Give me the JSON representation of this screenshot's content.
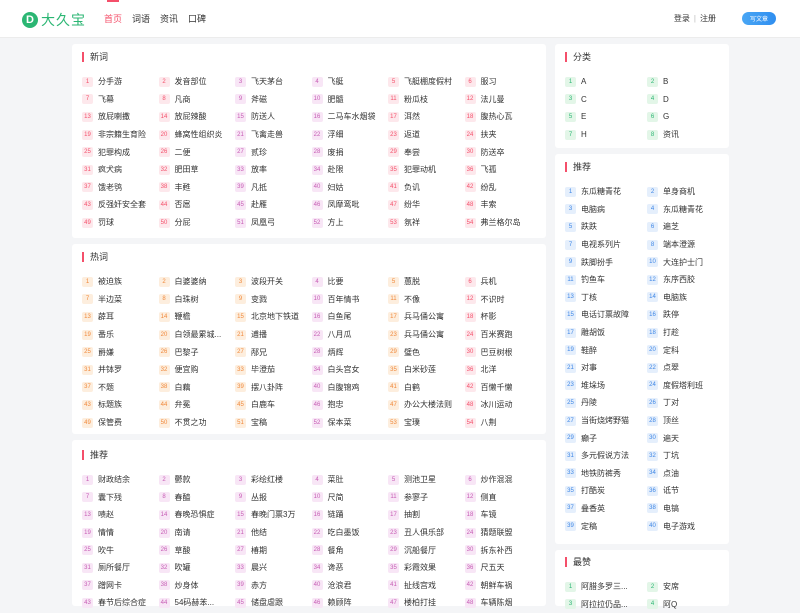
{
  "header": {
    "logo_letter": "D",
    "logo_text": "大久宝",
    "nav": [
      "首页",
      "词语",
      "资讯",
      "口碑"
    ],
    "login": "登录",
    "separator": "|",
    "register": "注册",
    "write_button": "写文章"
  },
  "sections": {
    "new": {
      "title": "新词",
      "items": [
        "分手游",
        "发音部位",
        "飞天茅台",
        "飞艇",
        "飞艇棚度假村",
        "服习",
        "飞幕",
        "凡商",
        "斧磁",
        "肥髓",
        "粉瓜枝",
        "法儿曼",
        "放屁喇撒",
        "放屁辣酸",
        "防送人",
        "二马车水烟袋",
        "洱然",
        "腹热心瓦",
        "非宗籍生育险",
        "蜂窝性组织炎",
        "飞禽走兽",
        "浮细",
        "返道",
        "扶夹",
        "犯罪构成",
        "二便",
        "贰珍",
        "废捐",
        "奉尝",
        "防送卒",
        "疯犬病",
        "肥田草",
        "放率",
        "赴限",
        "犯罪动机",
        "飞孤",
        "饿老鸮",
        "丰甦",
        "凡抵",
        "妇姑",
        "负讥",
        "纷乱",
        "反强奸安全套",
        "否扈",
        "赴雁",
        "凤靡鸾吡",
        "纷华",
        "丰索",
        "罚球",
        "分屁",
        "凤凰弓",
        "方上",
        "氛祥",
        "弗兰格尔岛"
      ]
    },
    "hot": {
      "title": "热词",
      "items": [
        "被迫族",
        "白婆婆纳",
        "波段开关",
        "比要",
        "蕙脱",
        "兵机",
        "半边菜",
        "白珠树",
        "变戮",
        "百年情书",
        "不像",
        "不识时",
        "薜耳",
        "鞭檐",
        "北京地下铁道",
        "白鱼尾",
        "兵马俑公寓",
        "杯影",
        "番乐",
        "白领最累城...",
        "逋播",
        "八月瓜",
        "兵马俑公寓",
        "百米赛跑",
        "爵嫌",
        "巴黎子",
        "邴兄",
        "炳辉",
        "璧色",
        "巴豆树根",
        "并钵罗",
        "便宜购",
        "毕澄茄",
        "白头宫女",
        "白米砂莲",
        "北洋",
        "不题",
        "白藕",
        "摆八卦阵",
        "白腹锦鸡",
        "白鹤",
        "百懒千懒",
        "标题族",
        "弁冕",
        "白鹿车",
        "抱忠",
        "办公大楼法则",
        "冰川运动",
        "保管费",
        "不贯之功",
        "宝稿",
        "保本菜",
        "宝璞",
        "八荆"
      ]
    },
    "rec": {
      "title": "推荐",
      "items": [
        "财政结余",
        "鬱款",
        "彩绘红楼",
        "菜肚",
        "测池卫星",
        "炒作混混",
        "囊下残",
        "春醯",
        "丛报",
        "尺简",
        "参寥子",
        "侧直",
        "啧赵",
        "春晚恐惧症",
        "春晚门票3万",
        "链踊",
        "抽割",
        "车镜",
        "情情",
        "南请",
        "他结",
        "吃白墨饭",
        "丑人俱乐部",
        "猜题联盟",
        "吹牛",
        "草酸",
        "椿期",
        "餐角",
        "沉船餐厅",
        "拆东补西",
        "厕所餐厅",
        "吹罐",
        "晨兴",
        "谗恶",
        "彩霞效果",
        "尺五天",
        "蹭网卡",
        "炒身体",
        "赤方",
        "沧浪君",
        "扯线宫戏",
        "朝鲜车祸",
        "春节后综合症",
        "54码赫苯...",
        "储盘虐跟",
        "赖顾阵",
        "楼柏打挂",
        "车辆陈烟"
      ]
    }
  },
  "sidebar": {
    "category": {
      "title": "分类",
      "items": [
        "A",
        "B",
        "C",
        "D",
        "E",
        "G",
        "H",
        "资讯"
      ]
    },
    "recommend": {
      "title": "推荐",
      "items": [
        "东瓜糖青花",
        "单身商机",
        "电脑病",
        "东瓜糖青花",
        "跌跌",
        "遍芝",
        "电视系列片",
        "端本澄源",
        "跌脚扮手",
        "大连护士门",
        "钓鱼车",
        "东序西胶",
        "丁核",
        "电脑族",
        "电话订票故障",
        "跌停",
        "雕胡饭",
        "打趁",
        "鞋醉",
        "定科",
        "对事",
        "点翠",
        "堆垛场",
        "度假塔利班",
        "丹陵",
        "丁对",
        "当街烧烤野猫",
        "顶丝",
        "癫子",
        "遍天",
        "多元假说方法",
        "丁坑",
        "地铁防裤秀",
        "点油",
        "打酷炭",
        "诋节",
        "叠香英",
        "电镐",
        "定稿",
        "电子游戏"
      ]
    },
    "most": {
      "title": "最赞",
      "items": [
        "阿腊多罗三...",
        "安席",
        "阿拉拉仍品...",
        "阿Q"
      ]
    }
  }
}
